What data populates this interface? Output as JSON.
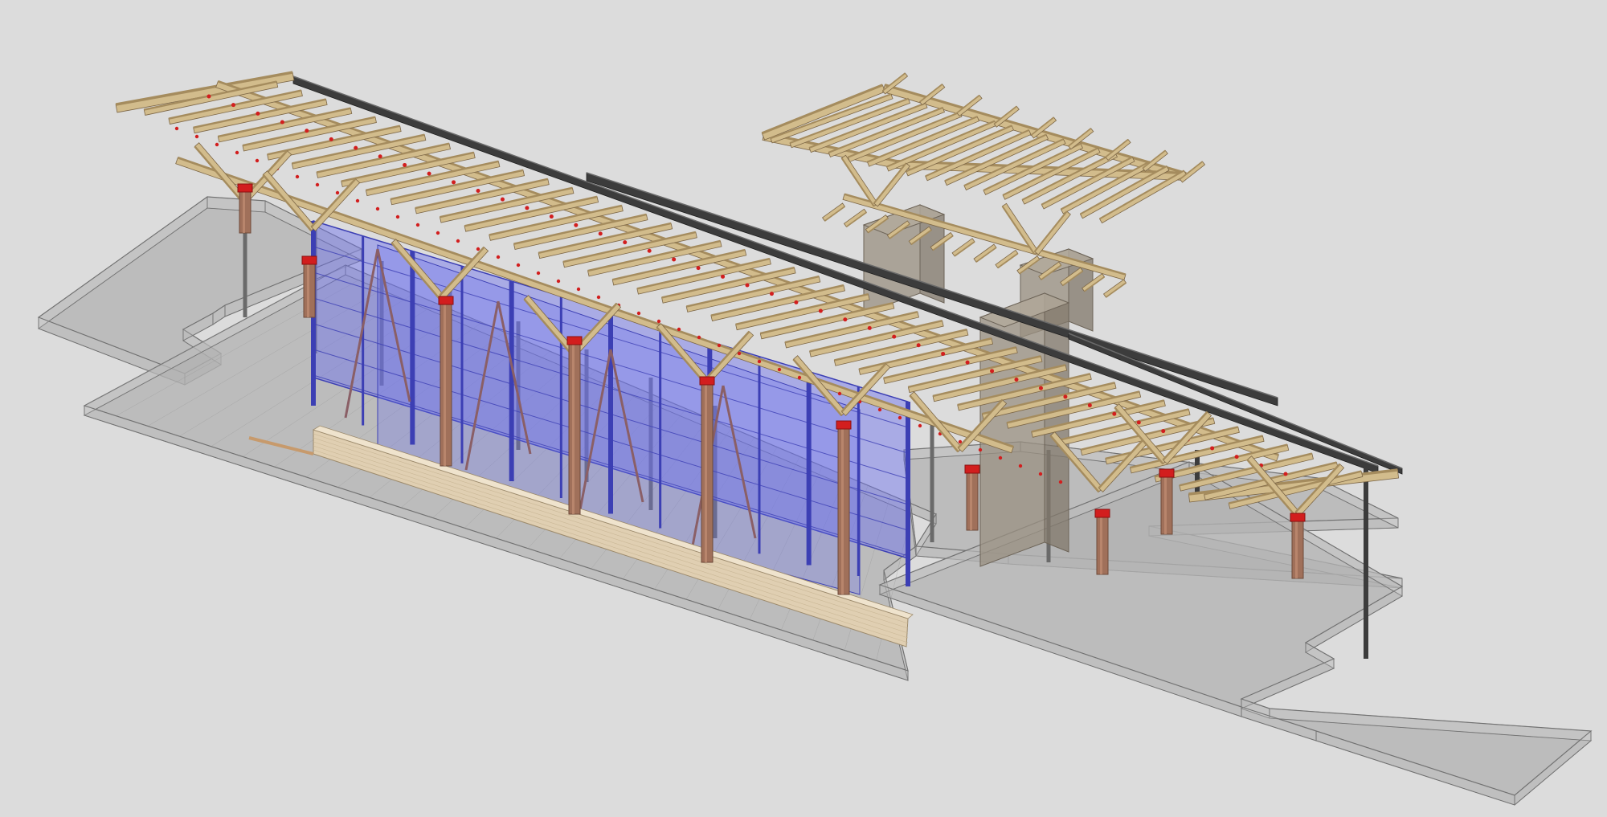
{
  "viewport": {
    "background": "#dcdcdc"
  },
  "colors": {
    "timber": "#d2bc8c",
    "timber_dark": "#a58c5e",
    "timber_edge": "#7c6646",
    "steel": "#3c3c3c",
    "slab_fill": "#b8b8b8",
    "slab_edge": "#707070",
    "glazing": "#6b6ff0",
    "glazing_mullion": "#3c3fb4",
    "concrete": "#9a9082",
    "column_wood": "#a0705a",
    "connector": "#d21e1e",
    "bench": "#e0cfb2"
  }
}
